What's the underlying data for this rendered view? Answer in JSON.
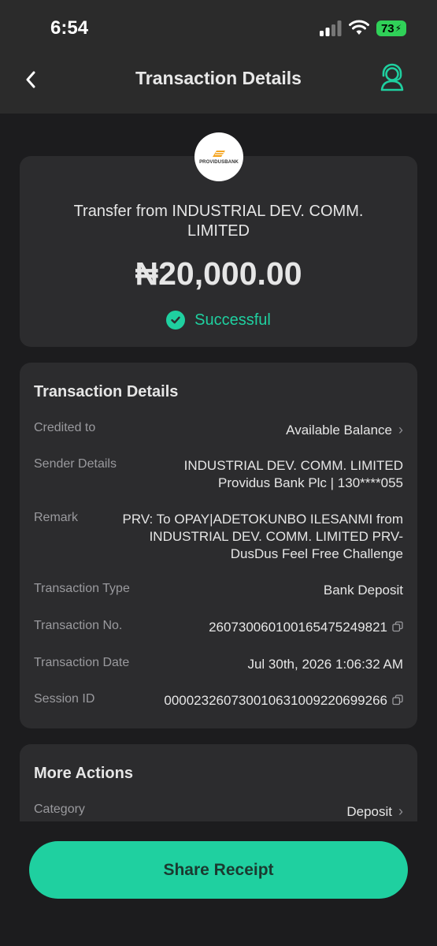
{
  "status_bar": {
    "time": "6:54",
    "battery": "73"
  },
  "nav": {
    "title": "Transaction Details"
  },
  "bank": {
    "logo_text": "PROVIDUSBANK"
  },
  "summary": {
    "title": "Transfer from INDUSTRIAL DEV. COMM. LIMITED",
    "amount": "₦20,000.00",
    "status": "Successful"
  },
  "details": {
    "heading": "Transaction Details",
    "credited_to": {
      "label": "Credited to",
      "value": "Available Balance"
    },
    "sender": {
      "label": "Sender Details",
      "line1": "INDUSTRIAL DEV. COMM. LIMITED",
      "line2": "Providus Bank Plc | 130****055"
    },
    "remark": {
      "label": "Remark",
      "line1": "PRV: To OPAY|ADETOKUNBO ILESANMI from",
      "line2": "INDUSTRIAL DEV. COMM. LIMITED PRV-",
      "line3": "DusDus Feel Free Challenge"
    },
    "type": {
      "label": "Transaction Type",
      "value": "Bank Deposit"
    },
    "number": {
      "label": "Transaction No.",
      "value": "260730060100165475249821"
    },
    "date": {
      "label": "Transaction Date",
      "value": "Jul 30th, 2026 1:06:32 AM"
    },
    "session": {
      "label": "Session ID",
      "value": "000023260730010631009220699266"
    }
  },
  "more_actions": {
    "heading": "More Actions",
    "category": {
      "label": "Category",
      "value": "Deposit"
    }
  },
  "share_button": {
    "label": "Share Receipt"
  },
  "colors": {
    "accent": "#1fd0a0",
    "background": "#1c1c1e",
    "card": "#2c2c2e",
    "header": "#2b2b2b"
  }
}
